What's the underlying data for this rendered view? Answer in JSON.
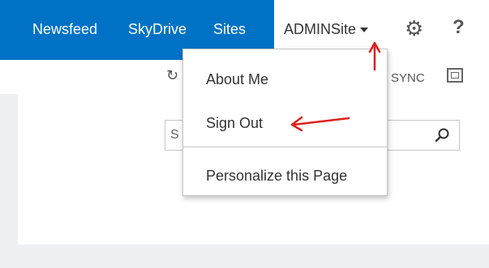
{
  "topbar": {
    "accent": "#0072c6",
    "nav": [
      "Newsfeed",
      "SkyDrive",
      "Sites"
    ],
    "account": "ADMINSite",
    "settings_icon": "gear-icon",
    "help_label": "?"
  },
  "toolbar": {
    "share_icon": "share-icon",
    "sync_label": "SYNC",
    "focus_icon": "focus-icon"
  },
  "search": {
    "placeholder": "S",
    "icon": "search-icon"
  },
  "menu": {
    "items": [
      "About Me",
      "Sign Out",
      "Personalize this Page"
    ]
  },
  "annotations": {
    "color": "#e0201b"
  }
}
